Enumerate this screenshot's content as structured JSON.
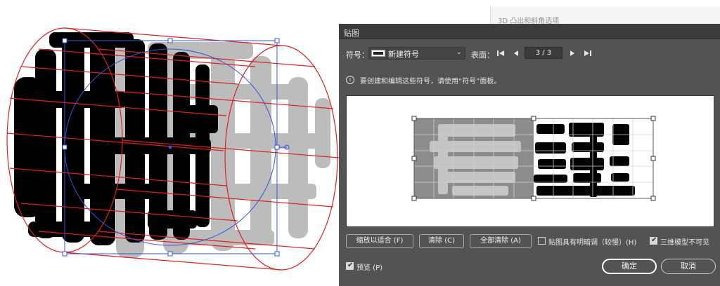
{
  "background_window": {
    "title": "3D 凸出和斜角选项"
  },
  "dialog": {
    "title": "贴图",
    "symbol_label": "符号：",
    "symbol_value": "新建符号",
    "surface_label": "表面：",
    "surface_value": "3 / 3",
    "info_text": "要创建和编辑这些符号，请使用“符号”面板。",
    "buttons": {
      "scale_to_fit": "缩放以适合 (F)",
      "clear": "清除 (C)",
      "clear_all": "全部清除 (A)",
      "ok": "确定",
      "cancel": "取消"
    },
    "checkboxes": {
      "shade_artwork": {
        "label": "贴图具有明暗调（较慢）(H)",
        "checked": false
      },
      "invisible_geometry": {
        "label": "三维模型不可见",
        "checked": true
      },
      "preview": {
        "label": "预览 (P)",
        "checked": true
      }
    }
  },
  "colors": {
    "dialog_bg": "#535353",
    "wireframe": "#e02020",
    "bounding_box": "#3355dd",
    "mapped_art": "#000000",
    "ghost_art": "#bcbcbc"
  }
}
